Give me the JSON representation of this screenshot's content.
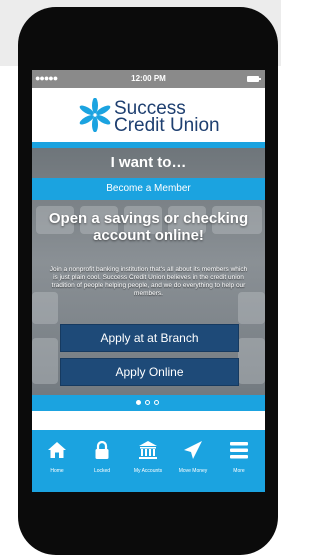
{
  "status_bar": {
    "signal_dots": "●●●●●",
    "time": "12:00 PM"
  },
  "logo": {
    "line1": "Success",
    "line2": "Credit Union",
    "icon": "starburst-logo-icon"
  },
  "hero": {
    "heading": "I want to…",
    "tab_label": "Become a Member",
    "headline": "Open a savings or checking account online!",
    "body": "Join a nonprofit banking institution that's all about its members which is just plain cool.  Success Credit Union believes in the credit union tradition of people helping people, and we do everything to help our members.",
    "buttons": {
      "branch": "Apply at at Branch",
      "online": "Apply Online"
    },
    "pager": {
      "count": 3,
      "active_index": 0
    }
  },
  "tabbar": {
    "items": [
      {
        "label": "Home",
        "icon": "home-icon"
      },
      {
        "label": "Locked",
        "icon": "lock-icon"
      },
      {
        "label": "My Accounts",
        "icon": "bank-icon"
      },
      {
        "label": "Move Money",
        "icon": "paper-plane-icon"
      },
      {
        "label": "More",
        "icon": "menu-icon"
      }
    ]
  },
  "colors": {
    "accent": "#1ba3e0",
    "brand_navy": "#1e3f70",
    "button": "#1e4a78"
  }
}
